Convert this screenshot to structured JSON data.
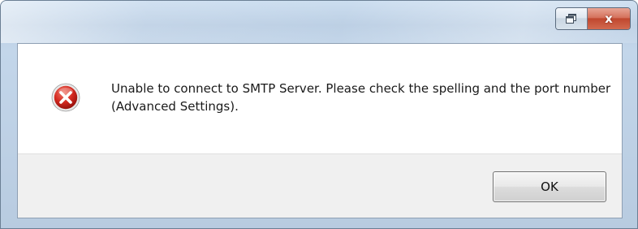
{
  "window": {
    "caption_buttons": {
      "restore_icon": "restore-window-icon",
      "close_label": "x"
    }
  },
  "dialog": {
    "icon": "error-icon",
    "message": "Unable to connect to SMTP Server. Please check the spelling and the port number (Advanced Settings).",
    "ok_label": "OK"
  },
  "colors": {
    "error_red": "#c8201b",
    "close_button": "#c0472e",
    "footer_background": "#f0f0f0"
  }
}
